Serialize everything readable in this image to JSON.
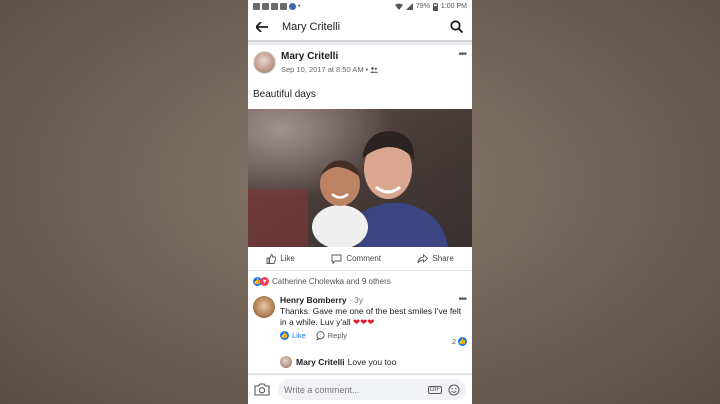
{
  "status_bar": {
    "battery": "79%",
    "time": "1:00 PM"
  },
  "header": {
    "title": "Mary Critelli"
  },
  "post": {
    "author": "Mary Critelli",
    "date": "Sep 10, 2017 at 8:50 AM",
    "text": "Beautiful days",
    "actions": {
      "like": "Like",
      "comment": "Comment",
      "share": "Share"
    },
    "reactions_text": "Catherine Cholewka and 9 others"
  },
  "comment": {
    "author": "Henry Bomberry",
    "time": "· 3y",
    "text": "Thanks. Gave me one of the best smiles I've felt in a while. Luv y'all",
    "hearts": "❤❤❤",
    "like_label": "Like",
    "reply_label": "Reply",
    "like_count": "2"
  },
  "reply": {
    "author": "Mary Critelli",
    "text": "Love you too"
  },
  "composer": {
    "placeholder": "Write a comment...",
    "gif": "GIF"
  },
  "colors": {
    "facebook_blue": "#1877f2",
    "love_red": "#f33e58"
  }
}
